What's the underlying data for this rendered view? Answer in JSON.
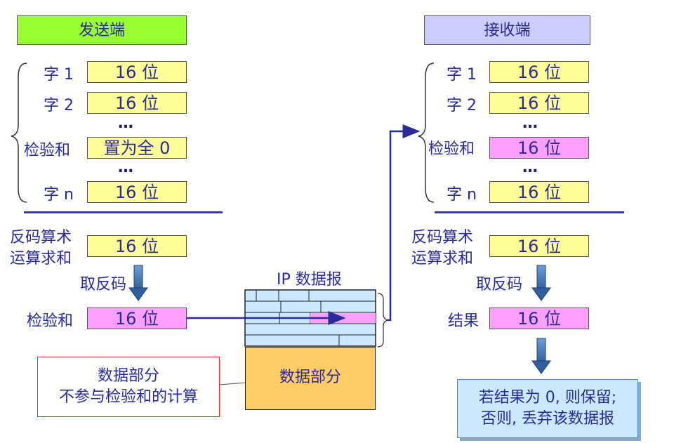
{
  "sender": {
    "title": "发送端",
    "rows": [
      {
        "label": "字 1",
        "value": "16 位"
      },
      {
        "label": "字 2",
        "value": "16 位"
      },
      {
        "label": "检验和",
        "value": "置为全 0"
      },
      {
        "label": "字 n",
        "value": "16 位"
      }
    ],
    "ellipsis": "…",
    "sum_label_line1": "反码算术",
    "sum_label_line2": "运算求和",
    "sum_value": "16 位",
    "complement_label": "取反码",
    "checksum_label": "检验和",
    "checksum_value": "16 位"
  },
  "receiver": {
    "title": "接收端",
    "rows": [
      {
        "label": "字 1",
        "value": "16 位"
      },
      {
        "label": "字 2",
        "value": "16 位"
      },
      {
        "label": "检验和",
        "value": "16 位"
      },
      {
        "label": "字 n",
        "value": "16 位"
      }
    ],
    "ellipsis": "…",
    "sum_label_line1": "反码算术",
    "sum_label_line2": "运算求和",
    "sum_value": "16 位",
    "complement_label": "取反码",
    "result_label": "结果",
    "result_value": "16 位",
    "decision_line1": "若结果为 0, 则保留;",
    "decision_line2": "否则, 丢弃该数据报"
  },
  "datagram": {
    "title": "IP 数据报",
    "data_part": "数据部分"
  },
  "data_note": {
    "line1": "数据部分",
    "line2": "不参与检验和的计算"
  },
  "colors": {
    "sender_header": "#99ff33",
    "receiver_header": "#ccccff",
    "field_yellow": "#ffff99",
    "field_pink": "#ffa0ff",
    "header_grid": "#cce8ff",
    "data_part": "#ffcc66",
    "decision_box": "#cce8ff",
    "line_blue": "#3a3aa0",
    "arrow_steel": "#3a6fb5"
  }
}
